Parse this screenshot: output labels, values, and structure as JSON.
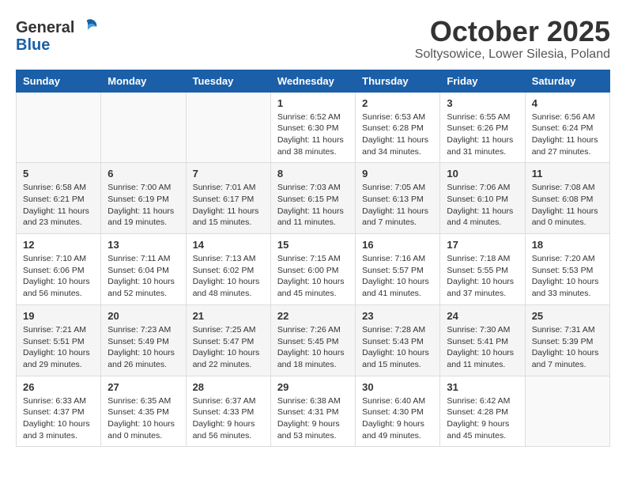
{
  "header": {
    "logo_general": "General",
    "logo_blue": "Blue",
    "month": "October 2025",
    "location": "Soltysowice, Lower Silesia, Poland"
  },
  "weekdays": [
    "Sunday",
    "Monday",
    "Tuesday",
    "Wednesday",
    "Thursday",
    "Friday",
    "Saturday"
  ],
  "weeks": [
    [
      {
        "day": "",
        "info": ""
      },
      {
        "day": "",
        "info": ""
      },
      {
        "day": "",
        "info": ""
      },
      {
        "day": "1",
        "info": "Sunrise: 6:52 AM\nSunset: 6:30 PM\nDaylight: 11 hours\nand 38 minutes."
      },
      {
        "day": "2",
        "info": "Sunrise: 6:53 AM\nSunset: 6:28 PM\nDaylight: 11 hours\nand 34 minutes."
      },
      {
        "day": "3",
        "info": "Sunrise: 6:55 AM\nSunset: 6:26 PM\nDaylight: 11 hours\nand 31 minutes."
      },
      {
        "day": "4",
        "info": "Sunrise: 6:56 AM\nSunset: 6:24 PM\nDaylight: 11 hours\nand 27 minutes."
      }
    ],
    [
      {
        "day": "5",
        "info": "Sunrise: 6:58 AM\nSunset: 6:21 PM\nDaylight: 11 hours\nand 23 minutes."
      },
      {
        "day": "6",
        "info": "Sunrise: 7:00 AM\nSunset: 6:19 PM\nDaylight: 11 hours\nand 19 minutes."
      },
      {
        "day": "7",
        "info": "Sunrise: 7:01 AM\nSunset: 6:17 PM\nDaylight: 11 hours\nand 15 minutes."
      },
      {
        "day": "8",
        "info": "Sunrise: 7:03 AM\nSunset: 6:15 PM\nDaylight: 11 hours\nand 11 minutes."
      },
      {
        "day": "9",
        "info": "Sunrise: 7:05 AM\nSunset: 6:13 PM\nDaylight: 11 hours\nand 7 minutes."
      },
      {
        "day": "10",
        "info": "Sunrise: 7:06 AM\nSunset: 6:10 PM\nDaylight: 11 hours\nand 4 minutes."
      },
      {
        "day": "11",
        "info": "Sunrise: 7:08 AM\nSunset: 6:08 PM\nDaylight: 11 hours\nand 0 minutes."
      }
    ],
    [
      {
        "day": "12",
        "info": "Sunrise: 7:10 AM\nSunset: 6:06 PM\nDaylight: 10 hours\nand 56 minutes."
      },
      {
        "day": "13",
        "info": "Sunrise: 7:11 AM\nSunset: 6:04 PM\nDaylight: 10 hours\nand 52 minutes."
      },
      {
        "day": "14",
        "info": "Sunrise: 7:13 AM\nSunset: 6:02 PM\nDaylight: 10 hours\nand 48 minutes."
      },
      {
        "day": "15",
        "info": "Sunrise: 7:15 AM\nSunset: 6:00 PM\nDaylight: 10 hours\nand 45 minutes."
      },
      {
        "day": "16",
        "info": "Sunrise: 7:16 AM\nSunset: 5:57 PM\nDaylight: 10 hours\nand 41 minutes."
      },
      {
        "day": "17",
        "info": "Sunrise: 7:18 AM\nSunset: 5:55 PM\nDaylight: 10 hours\nand 37 minutes."
      },
      {
        "day": "18",
        "info": "Sunrise: 7:20 AM\nSunset: 5:53 PM\nDaylight: 10 hours\nand 33 minutes."
      }
    ],
    [
      {
        "day": "19",
        "info": "Sunrise: 7:21 AM\nSunset: 5:51 PM\nDaylight: 10 hours\nand 29 minutes."
      },
      {
        "day": "20",
        "info": "Sunrise: 7:23 AM\nSunset: 5:49 PM\nDaylight: 10 hours\nand 26 minutes."
      },
      {
        "day": "21",
        "info": "Sunrise: 7:25 AM\nSunset: 5:47 PM\nDaylight: 10 hours\nand 22 minutes."
      },
      {
        "day": "22",
        "info": "Sunrise: 7:26 AM\nSunset: 5:45 PM\nDaylight: 10 hours\nand 18 minutes."
      },
      {
        "day": "23",
        "info": "Sunrise: 7:28 AM\nSunset: 5:43 PM\nDaylight: 10 hours\nand 15 minutes."
      },
      {
        "day": "24",
        "info": "Sunrise: 7:30 AM\nSunset: 5:41 PM\nDaylight: 10 hours\nand 11 minutes."
      },
      {
        "day": "25",
        "info": "Sunrise: 7:31 AM\nSunset: 5:39 PM\nDaylight: 10 hours\nand 7 minutes."
      }
    ],
    [
      {
        "day": "26",
        "info": "Sunrise: 6:33 AM\nSunset: 4:37 PM\nDaylight: 10 hours\nand 3 minutes."
      },
      {
        "day": "27",
        "info": "Sunrise: 6:35 AM\nSunset: 4:35 PM\nDaylight: 10 hours\nand 0 minutes."
      },
      {
        "day": "28",
        "info": "Sunrise: 6:37 AM\nSunset: 4:33 PM\nDaylight: 9 hours\nand 56 minutes."
      },
      {
        "day": "29",
        "info": "Sunrise: 6:38 AM\nSunset: 4:31 PM\nDaylight: 9 hours\nand 53 minutes."
      },
      {
        "day": "30",
        "info": "Sunrise: 6:40 AM\nSunset: 4:30 PM\nDaylight: 9 hours\nand 49 minutes."
      },
      {
        "day": "31",
        "info": "Sunrise: 6:42 AM\nSunset: 4:28 PM\nDaylight: 9 hours\nand 45 minutes."
      },
      {
        "day": "",
        "info": ""
      }
    ]
  ]
}
